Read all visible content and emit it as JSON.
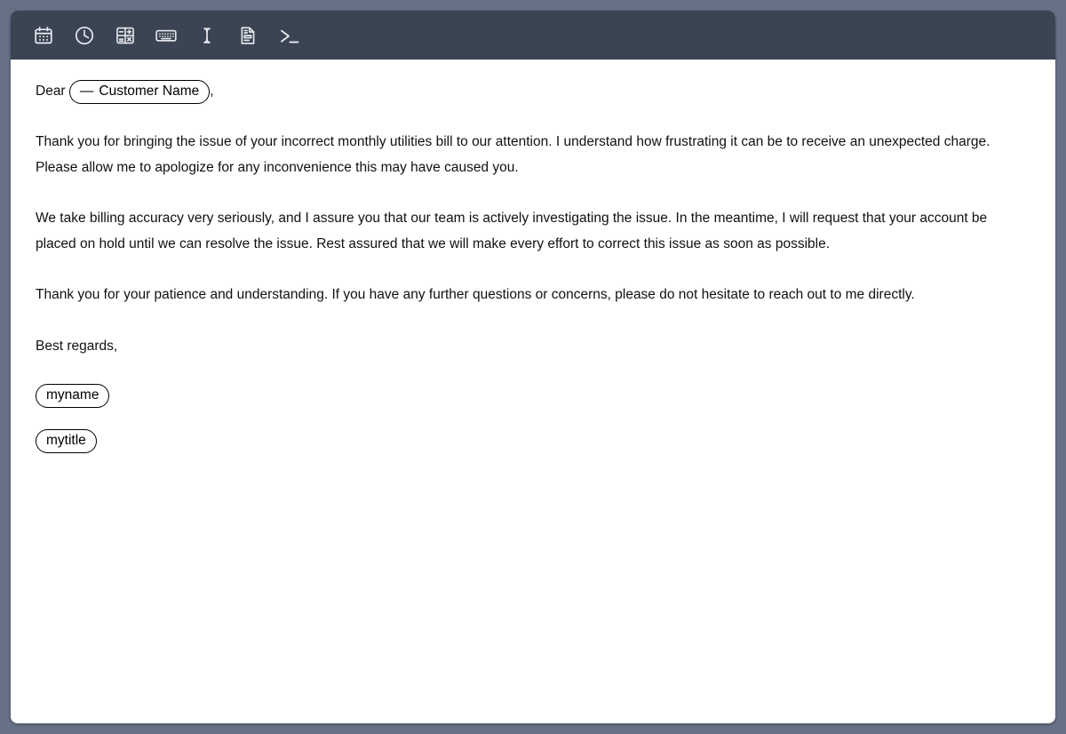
{
  "window": {
    "background_color": "#667086",
    "toolbar_color": "#3a4453",
    "page_color": "#ffffff"
  },
  "toolbar": {
    "items": [
      {
        "icon": "calendar-icon",
        "label": "Date"
      },
      {
        "icon": "clock-icon",
        "label": "Time"
      },
      {
        "icon": "calculator-icon",
        "label": "Calculator"
      },
      {
        "icon": "keyboard-icon",
        "label": "Keyboard"
      },
      {
        "icon": "text-cursor-icon",
        "label": "Text cursor"
      },
      {
        "icon": "document-icon",
        "label": "Document"
      },
      {
        "icon": "terminal-prompt-icon",
        "label": "Terminal"
      }
    ]
  },
  "letter": {
    "salutation": {
      "prefix": "Dear ",
      "variable_dash": "—",
      "variable_label": "Customer Name",
      "suffix": ","
    },
    "paragraphs": [
      "Thank you for bringing the issue of your incorrect monthly utilities bill to our attention. I understand how frustrating it can be to receive an unexpected charge. Please allow me to apologize for any inconvenience this may have caused you.",
      "We take billing accuracy very seriously, and I assure you that our team is actively investigating the issue. In the meantime, I will request that your account be placed on hold until we can resolve the issue. Rest assured that we will make every effort to correct this issue as soon as possible.",
      "Thank you for your patience and understanding. If you have any further questions or concerns, please do not hesitate to reach out to me directly."
    ],
    "signoff": "Best regards,",
    "signature_fields": [
      {
        "label": "myname"
      },
      {
        "label": "mytitle"
      }
    ]
  }
}
